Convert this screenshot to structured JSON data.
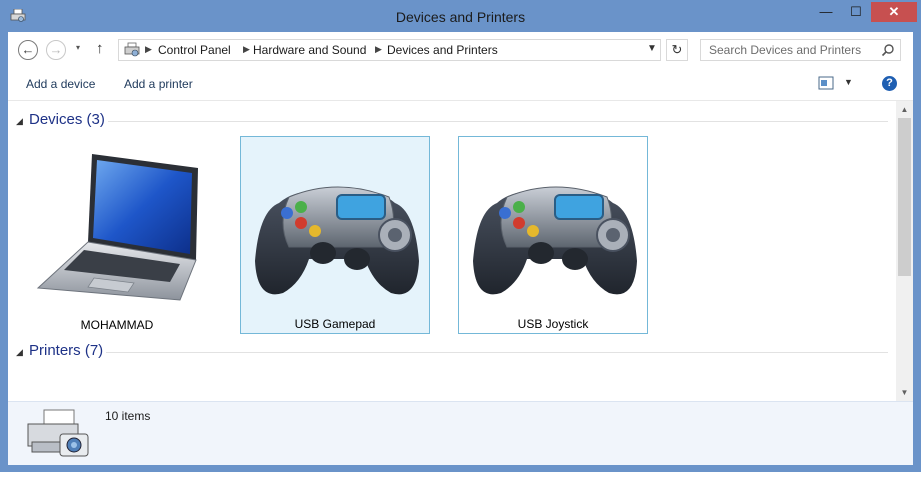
{
  "window": {
    "title": "Devices and Printers"
  },
  "titlebar": {
    "min": "—",
    "max": "☐",
    "close": "✕"
  },
  "nav": {
    "back": "←",
    "forward": "→",
    "recent": "▾",
    "up": "↑",
    "breadcrumbs": [
      "Control Panel",
      "Hardware and Sound",
      "Devices and Printers"
    ],
    "refresh": "↻",
    "search_placeholder": "Search Devices and Printers"
  },
  "toolbar": {
    "add_device": "Add a device",
    "add_printer": "Add a printer",
    "help": "?"
  },
  "groups": {
    "devices": {
      "title": "Devices (3)"
    },
    "printers": {
      "title": "Printers (7)"
    }
  },
  "devices": [
    {
      "label": "MOHAMMAD",
      "icon": "laptop-icon"
    },
    {
      "label": "USB Gamepad",
      "icon": "gamepad-icon"
    },
    {
      "label": "USB Joystick",
      "icon": "gamepad-icon"
    }
  ],
  "status": {
    "count": "10 items"
  },
  "colors": {
    "titlebar": "#6a93c9",
    "close": "#c75050",
    "group_title": "#1e3287",
    "selection": "#e5f3fb",
    "selection_border": "#74b8d8"
  }
}
